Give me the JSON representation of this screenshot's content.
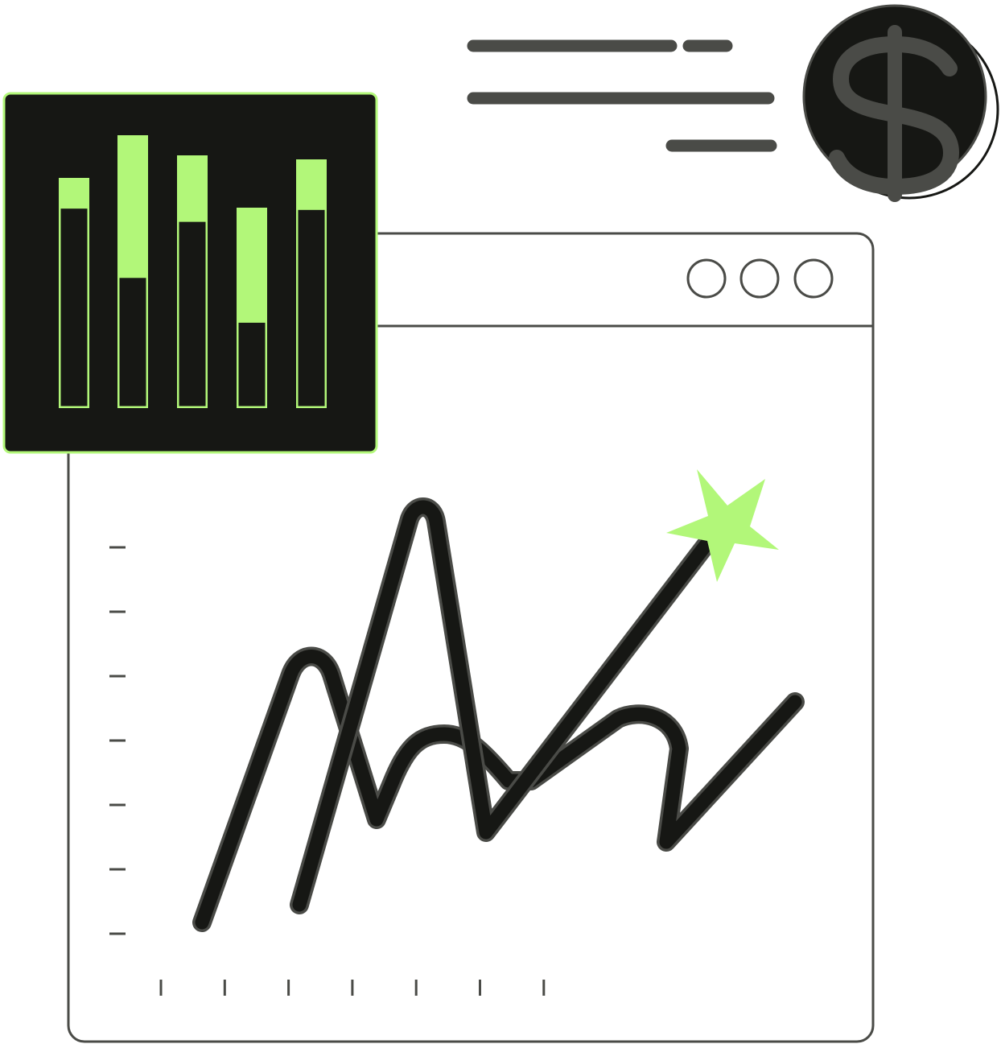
{
  "colors": {
    "background": "#ffffff",
    "ink": "#161714",
    "outline": "#4a4b47",
    "accent_green": "#b2f779",
    "text_bar": "#4a4b47"
  },
  "icons": {
    "coin": "dollar-coin-icon",
    "star": "star-icon",
    "window_dots": "circle-outline-icon"
  },
  "bar_panel": {
    "bars": [
      {
        "total": 1.0,
        "lower_fraction": 0.87
      },
      {
        "total": 1.0,
        "lower_fraction": 0.48
      },
      {
        "total": 1.0,
        "lower_fraction": 0.74
      },
      {
        "total": 1.0,
        "lower_fraction": 0.43
      },
      {
        "total": 1.0,
        "lower_fraction": 0.8
      }
    ]
  },
  "line_panel": {
    "y_tick_count": 7,
    "x_tick_count": 7,
    "series_count": 2
  }
}
